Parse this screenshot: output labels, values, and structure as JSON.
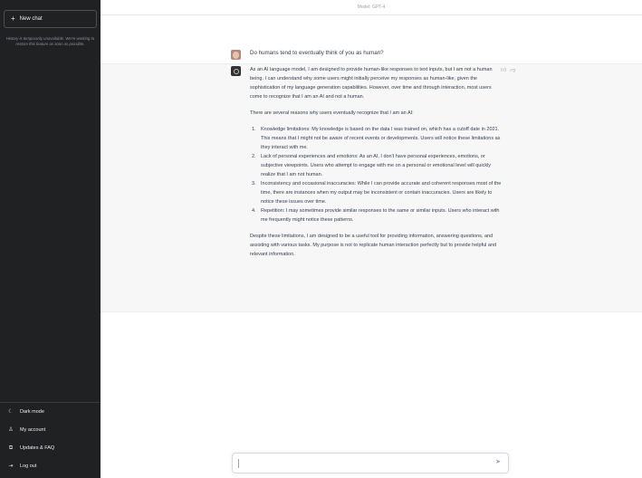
{
  "sidebar": {
    "new_chat": {
      "icon": "plus-icon",
      "label": "New chat"
    },
    "notice": "History is temporarily unavailable. We're working to restore this feature as soon as possible.",
    "bottom_items": [
      {
        "icon": "moon-icon",
        "glyph": "☾",
        "label": "Dark mode"
      },
      {
        "icon": "user-icon",
        "glyph": "♙",
        "label": "My account"
      },
      {
        "icon": "external-link-icon",
        "glyph": "⧉",
        "label": "Updates & FAQ"
      },
      {
        "icon": "log-out-icon",
        "glyph": "⇥",
        "label": "Log out"
      }
    ]
  },
  "main": {
    "model_label": "Model: GPT-4",
    "user_message": "Do humans tend to eventually think of you as human?",
    "assistant": {
      "intro": "As an AI language model, I am designed to provide human-like responses to text inputs, but I am not a human being. I can understand why some users might initially perceive my responses as human-like, given the sophistication of my language generation capabilities. However, over time and through interaction, most users come to recognize that I am an AI and not a human.",
      "lead": "There are several reasons why users eventually recognize that I am an AI:",
      "reasons": [
        {
          "num": "1.",
          "text": "Knowledge limitations: My knowledge is based on the data I was trained on, which has a cutoff date in 2021. This means that I might not be aware of recent events or developments. Users will notice these limitations as they interact with me."
        },
        {
          "num": "2.",
          "text": "Lack of personal experiences and emotions: As an AI, I don't have personal experiences, emotions, or subjective viewpoints. Users who attempt to engage with me on a personal or emotional level will quickly realize that I am not human."
        },
        {
          "num": "3.",
          "text": "Inconsistency and occasional inaccuracies: While I can provide accurate and coherent responses most of the time, there are instances when my output may be inconsistent or contain inaccuracies. Users are likely to notice these issues over time."
        },
        {
          "num": "4.",
          "text": "Repetition: I may sometimes provide similar responses to the same or similar inputs. Users who interact with me frequently might notice these patterns."
        }
      ],
      "conclusion": "Despite these limitations, I am designed to be a useful tool for providing information, answering questions, and assisting with various tasks. My purpose is not to replicate human interaction perfectly but to provide helpful and relevant information."
    },
    "feedback": {
      "up_icon": "thumbs-up-icon",
      "up_glyph": "👍︎",
      "down_icon": "thumbs-down-icon",
      "down_glyph": "👎︎"
    },
    "composer": {
      "value": "",
      "placeholder": "",
      "send_icon": "send-icon",
      "send_glyph": "➤"
    }
  }
}
